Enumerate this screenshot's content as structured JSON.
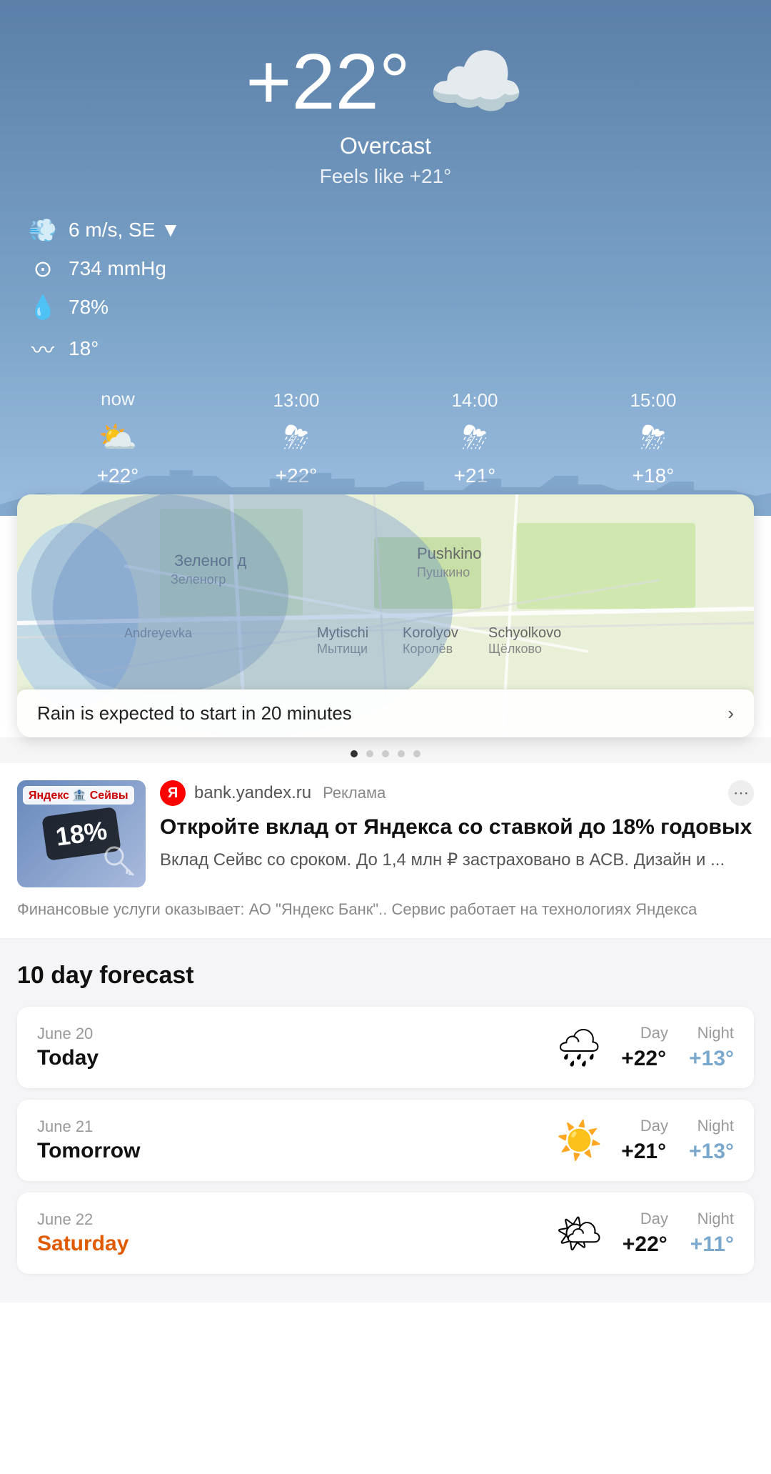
{
  "hero": {
    "temperature": "+22°",
    "description": "Overcast",
    "feels_like": "Feels like +21°",
    "cloud_emoji": "☁️"
  },
  "stats": [
    {
      "icon": "💨",
      "value": "6 m/s, SE ▼",
      "name": "wind"
    },
    {
      "icon": "⊙",
      "value": "734 mmHg",
      "name": "pressure"
    },
    {
      "icon": "💧",
      "value": "78%",
      "name": "humidity"
    },
    {
      "icon": "〰",
      "value": "18°",
      "name": "wave"
    }
  ],
  "hourly": [
    {
      "label": "now",
      "icon": "⛅",
      "temp": "+22°"
    },
    {
      "label": "13:00",
      "icon": "⛈",
      "temp": "+22°"
    },
    {
      "label": "14:00",
      "icon": "⛈",
      "temp": "+21°"
    },
    {
      "label": "15:00",
      "icon": "⛈",
      "temp": "+18°"
    }
  ],
  "map": {
    "rain_notice": "Rain is expected to start in 20 minutes"
  },
  "pagination": {
    "total": 5,
    "active": 0
  },
  "ad": {
    "site": "bank.yandex.ru",
    "ad_label": "Реклама",
    "badge": "18%",
    "logo_tag": "Яндекс 🏦 Сейвы",
    "title": "Откройте вклад от Яндекса со ставкой до 18% годовых",
    "desc": "Вклад Сейвс со сроком. До 1,4 млн ₽ застраховано в АСВ. Дизайн и ...",
    "disclaimer": "Финансовые услуги оказывает: АО \"Яндекс Банк\".. Сервис работает на технологиях Яндекса"
  },
  "forecast": {
    "title": "10 day forecast",
    "days": [
      {
        "date_sub": "June 20",
        "date_main": "Today",
        "is_weekend": false,
        "icon": "🌧",
        "day_temp": "+22°",
        "night_temp": "+13°"
      },
      {
        "date_sub": "June 21",
        "date_main": "Tomorrow",
        "is_weekend": false,
        "icon": "☀️",
        "day_temp": "+21°",
        "night_temp": "+13°"
      },
      {
        "date_sub": "June 22",
        "date_main": "Saturday",
        "is_weekend": true,
        "icon": "🌤",
        "day_temp": "+22°",
        "night_temp": "+11°"
      }
    ],
    "col_day": "Day",
    "col_night": "Night"
  }
}
